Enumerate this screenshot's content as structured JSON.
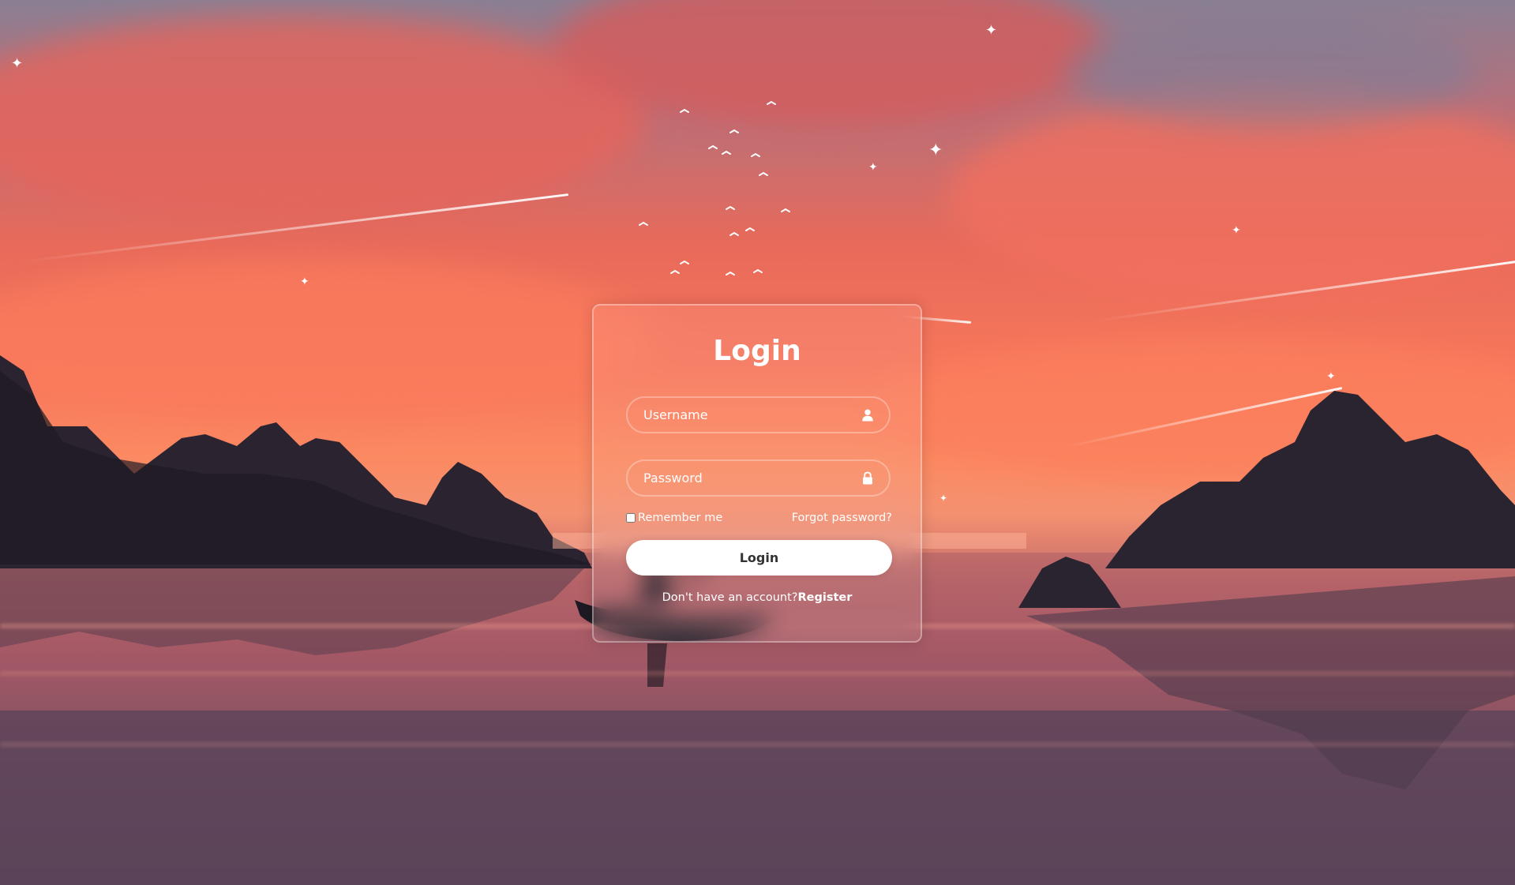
{
  "login_form": {
    "title": "Login",
    "username": {
      "placeholder": "Username",
      "value": "",
      "icon": "user-icon"
    },
    "password": {
      "placeholder": "Password",
      "value": "",
      "icon": "lock-icon"
    },
    "remember_me": {
      "label": "Remember me",
      "checked": false
    },
    "forgot_password_label": "Forgot password?",
    "submit_label": "Login",
    "register_prompt": "Don't have an account?",
    "register_label": "Register"
  },
  "theme": {
    "text_color": "#ffffff",
    "button_background": "#ffffff",
    "button_text_color": "#333333",
    "background_scene": "sunset-lake-kayak"
  }
}
